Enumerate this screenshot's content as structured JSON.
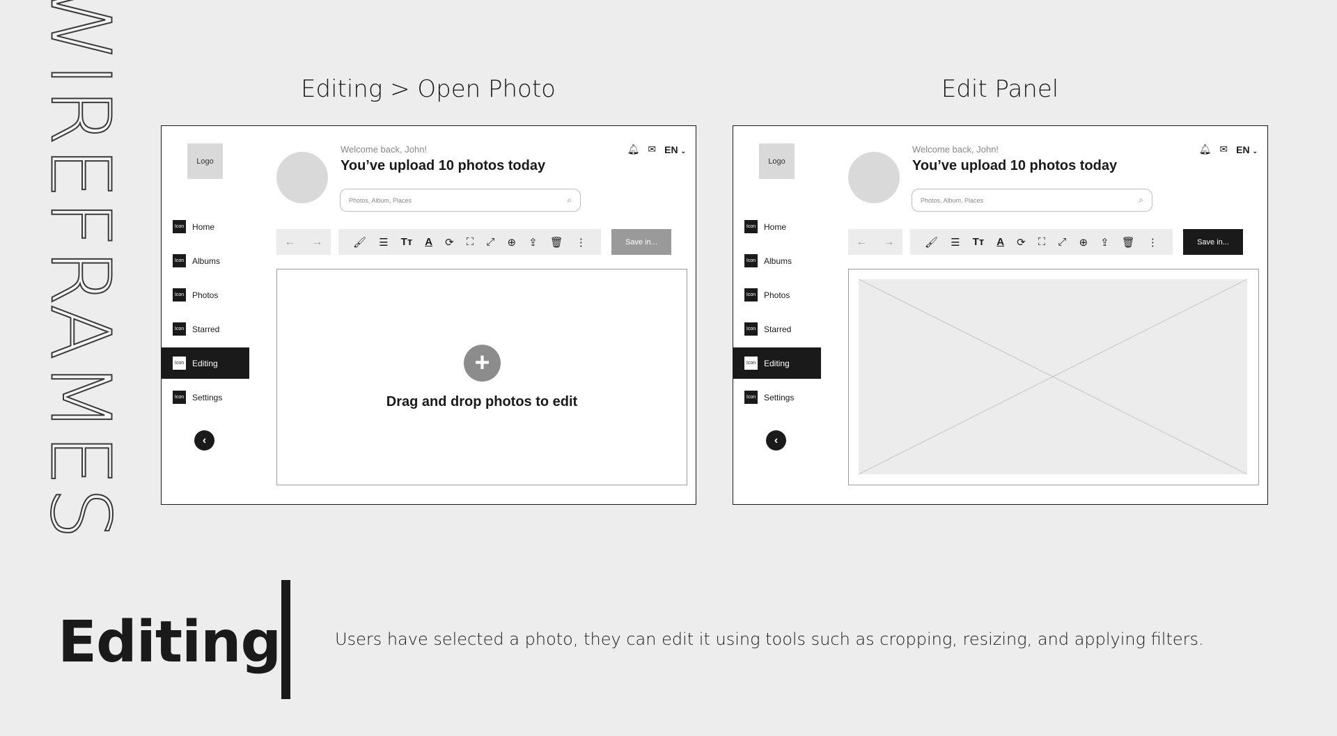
{
  "page": {
    "vertical_title": "WIREFRAMES",
    "section_title": "Editing",
    "description": "Users have selected a photo, they can edit it using tools such as cropping, resizing, and applying filters."
  },
  "frames": [
    {
      "title": "Editing > Open Photo",
      "logo": "Logo",
      "nav": [
        {
          "label": "Home",
          "icon": "Icon",
          "active": false
        },
        {
          "label": "Albums",
          "icon": "Icon",
          "active": false
        },
        {
          "label": "Photos",
          "icon": "Icon",
          "active": false
        },
        {
          "label": "Starred",
          "icon": "Icon",
          "active": false
        },
        {
          "label": "Editing",
          "icon": "Icon",
          "active": true
        },
        {
          "label": "Settings",
          "icon": "Icon",
          "active": false
        }
      ],
      "welcome": "Welcome back, John!",
      "headline": "You’ve upload 10 photos today",
      "search_placeholder": "Photos, Album, Places",
      "language": "EN",
      "save_label": "Save in...",
      "save_state": "disabled",
      "drop_text": "Drag and drop photos to edit"
    },
    {
      "title": "Edit Panel",
      "logo": "Logo",
      "nav": [
        {
          "label": "Home",
          "icon": "Icon",
          "active": false
        },
        {
          "label": "Albums",
          "icon": "Icon",
          "active": false
        },
        {
          "label": "Photos",
          "icon": "Icon",
          "active": false
        },
        {
          "label": "Starred",
          "icon": "Icon",
          "active": false
        },
        {
          "label": "Editing",
          "icon": "Icon",
          "active": true
        },
        {
          "label": "Settings",
          "icon": "Icon",
          "active": false
        }
      ],
      "welcome": "Welcome back, John!",
      "headline": "You’ve upload 10 photos today",
      "search_placeholder": "Photos, Album, Places",
      "language": "EN",
      "save_label": "Save in...",
      "save_state": "enabled",
      "drop_text": ""
    }
  ],
  "toolbar_icons": [
    "brush-icon",
    "sliders-icon",
    "text-size-icon",
    "text-color-icon",
    "rotate-icon",
    "crop-icon",
    "resize-icon",
    "add-circle-icon",
    "share-icon",
    "trash-icon",
    "more-icon"
  ],
  "colors": {
    "background": "#ededed",
    "ink": "#1a1a1a",
    "placeholder": "#d9d9d9",
    "disabled": "#9a9a9a"
  }
}
